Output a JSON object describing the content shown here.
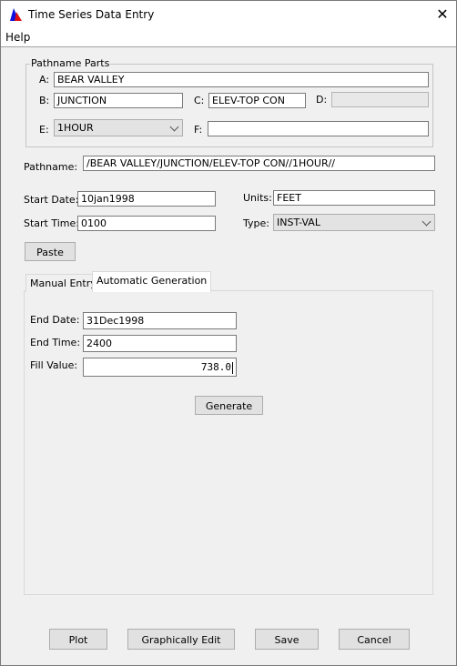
{
  "window": {
    "title": "Time Series Data Entry",
    "close_icon": "close-icon"
  },
  "menu": {
    "help": "Help"
  },
  "pathname_parts": {
    "legend": "Pathname Parts",
    "a_label": "A:",
    "a_value": "BEAR VALLEY",
    "b_label": "B:",
    "b_value": "JUNCTION",
    "c_label": "C:",
    "c_value": "ELEV-TOP CON",
    "d_label": "D:",
    "d_value": "",
    "e_label": "E:",
    "e_value": "1HOUR",
    "f_label": "F:",
    "f_value": ""
  },
  "pathname": {
    "label": "Pathname:",
    "value": "/BEAR VALLEY/JUNCTION/ELEV-TOP CON//1HOUR//"
  },
  "start": {
    "date_label": "Start Date:",
    "date_value": "10jan1998",
    "time_label": "Start Time:",
    "time_value": "0100"
  },
  "units": {
    "label": "Units:",
    "value": "FEET"
  },
  "type": {
    "label": "Type:",
    "value": "INST-VAL"
  },
  "paste_button": "Paste",
  "tabs": [
    {
      "label": "Manual Entry",
      "active": false
    },
    {
      "label": "Automatic Generation",
      "active": true
    }
  ],
  "auto_gen": {
    "end_date_label": "End Date:",
    "end_date_value": "31Dec1998",
    "end_time_label": "End Time:",
    "end_time_value": "2400",
    "fill_value_label": "Fill Value:",
    "fill_value": "738.0",
    "generate_button": "Generate"
  },
  "footer": {
    "plot": "Plot",
    "graphically_edit": "Graphically Edit",
    "save": "Save",
    "cancel": "Cancel"
  }
}
